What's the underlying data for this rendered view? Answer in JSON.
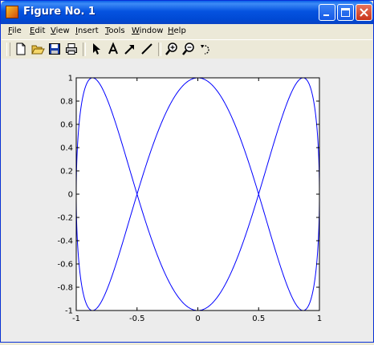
{
  "window": {
    "title": "Figure No. 1",
    "icon": "matlab-logo-icon",
    "controls": [
      "minimize-icon",
      "maximize-icon",
      "close-icon"
    ]
  },
  "menubar": {
    "items": [
      {
        "first": "F",
        "rest": "ile"
      },
      {
        "first": "E",
        "rest": "dit"
      },
      {
        "first": "V",
        "rest": "iew"
      },
      {
        "first": "I",
        "rest": "nsert"
      },
      {
        "first": "T",
        "rest": "ools"
      },
      {
        "first": "W",
        "rest": "indow"
      },
      {
        "first": "H",
        "rest": "elp"
      }
    ]
  },
  "toolbar": {
    "tools": [
      "new-file-icon",
      "open-folder-icon",
      "save-icon",
      "print-icon",
      "select-arrow-icon",
      "text-tool-icon",
      "arrow-tool-icon",
      "line-tool-icon",
      "zoom-in-icon",
      "zoom-out-icon",
      "rotate-icon"
    ]
  },
  "colors": {
    "title_bar": "#0553e0",
    "line": "#0000ff",
    "axes_background": "#ffffff",
    "figure_background": "#ececec"
  },
  "chart_data": {
    "type": "line",
    "title": "",
    "xlabel": "",
    "ylabel": "",
    "xlim": [
      -1,
      1
    ],
    "ylim": [
      -1,
      1
    ],
    "xticks": [
      "-1",
      "-0.5",
      "0",
      "0.5",
      "1"
    ],
    "yticks": [
      "1",
      "0.8",
      "0.6",
      "0.4",
      "0.2",
      "0",
      "-0.2",
      "-0.4",
      "-0.6",
      "-0.8",
      "-1"
    ],
    "grid": false,
    "series": [
      {
        "color": "#0000ff",
        "parametric": "x = sin(t), y = cos(3t)",
        "x": [
          0,
          0.259,
          0.5,
          0.707,
          0.866,
          0.966,
          1,
          0.966,
          0.866,
          0.707,
          0.5,
          0.259,
          0,
          -0.259,
          -0.5,
          -0.707,
          -0.866,
          -0.966,
          -1,
          -0.966,
          -0.866,
          -0.707,
          -0.5,
          -0.259,
          0
        ],
        "y": [
          1,
          0.707,
          0,
          -0.707,
          -1,
          -0.707,
          0,
          0.707,
          1,
          0.707,
          0,
          -0.707,
          -1,
          -0.707,
          0,
          0.707,
          1,
          0.707,
          0,
          -0.707,
          -1,
          -0.707,
          0,
          0.707,
          1
        ]
      }
    ]
  }
}
